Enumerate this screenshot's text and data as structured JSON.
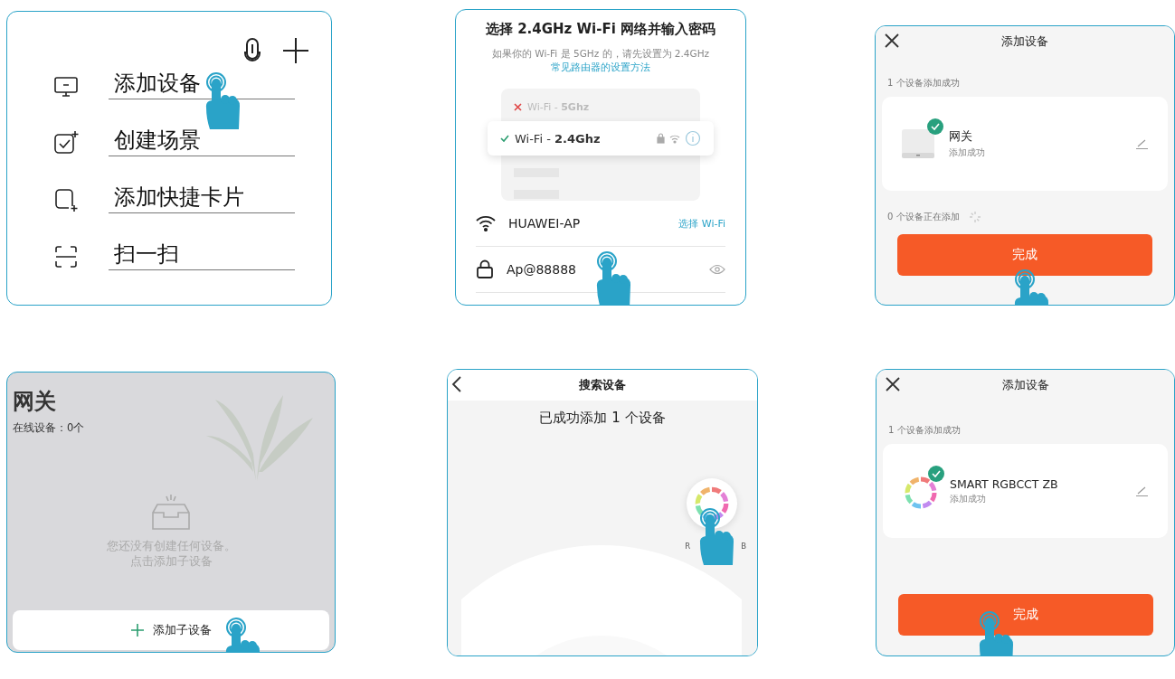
{
  "panels": [
    {
      "kind": "menu",
      "items": [
        {
          "label": "添加设备"
        },
        {
          "label": "创建场景"
        },
        {
          "label": "添加快捷卡片"
        },
        {
          "label": "扫一扫"
        }
      ]
    },
    {
      "kind": "wifi",
      "title": "选择 2.4GHz Wi-Fi 网络并输入密码",
      "description": "如果你的 Wi-Fi 是 5GHz 的，请先设置为 2.4GHz ",
      "link": "常见路由器的设置方法",
      "networks": [
        {
          "prefix": "Wi-Fi - ",
          "band": "5Ghz",
          "supported": false
        },
        {
          "prefix": "Wi-Fi - ",
          "band": "2.4Ghz",
          "supported": true
        }
      ],
      "ssid": "HUAWEI-AP",
      "choose_link": "选择 Wi-Fi",
      "password": "Ap@88888"
    },
    {
      "kind": "result",
      "title": "添加设备",
      "success_count": "1 个设备添加成功",
      "device": {
        "name": "网关",
        "status": "添加成功"
      },
      "pending": "0 个设备正在添加",
      "button": "完成"
    },
    {
      "kind": "gateway",
      "title": "网关",
      "online": "在线设备：0个",
      "empty_lines": [
        "您还没有创建任何设备。",
        "点击添加子设备"
      ],
      "add_button": "添加子设备"
    },
    {
      "kind": "search",
      "title": "搜索设备",
      "message": "已成功添加 1 个设备",
      "label_start": "R",
      "label_end": "B"
    },
    {
      "kind": "result",
      "title": "添加设备",
      "success_count": "1 个设备添加成功",
      "device": {
        "name": "SMART RGBCCT ZB",
        "status": "添加成功"
      },
      "button": "完成"
    }
  ]
}
